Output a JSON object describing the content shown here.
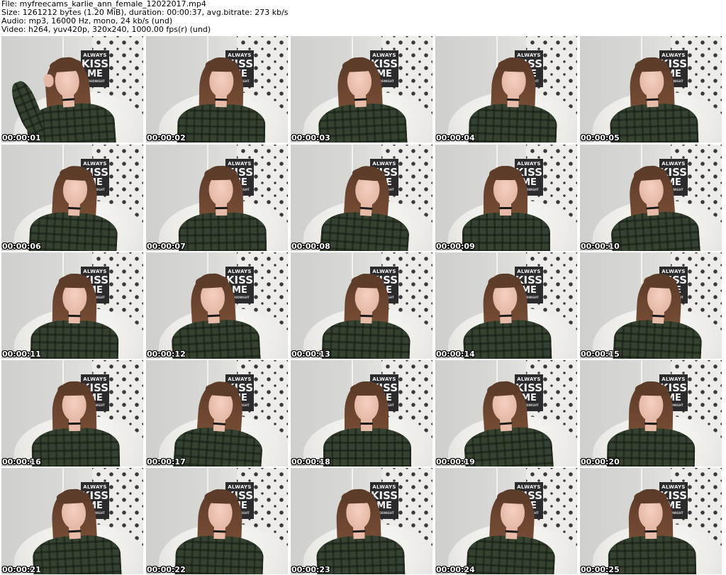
{
  "header": {
    "line1": "File: myfreecams_karlie_ann_female_12022017.mp4",
    "line2": "Size: 1261212 bytes (1.20 MiB), duration: 00:00:37, avg.bitrate: 273 kb/s",
    "line3": "Audio: mp3, 16000 Hz, mono, 24 kb/s (und)",
    "line4": "Video: h264, yuv420p, 320x240, 1000.00 fps(r) (und)"
  },
  "poster": {
    "line1": "ALWAYS",
    "line2": "KISS",
    "line3": "ME",
    "line4": "GOODNIGHT"
  },
  "thumbnails": [
    {
      "timestamp": "00:00:01"
    },
    {
      "timestamp": "00:00:02"
    },
    {
      "timestamp": "00:00:03"
    },
    {
      "timestamp": "00:00:04"
    },
    {
      "timestamp": "00:00:05"
    },
    {
      "timestamp": "00:00:06"
    },
    {
      "timestamp": "00:00:07"
    },
    {
      "timestamp": "00:00:08"
    },
    {
      "timestamp": "00:00:09"
    },
    {
      "timestamp": "00:00:10"
    },
    {
      "timestamp": "00:00:11"
    },
    {
      "timestamp": "00:00:12"
    },
    {
      "timestamp": "00:00:13"
    },
    {
      "timestamp": "00:00:14"
    },
    {
      "timestamp": "00:00:15"
    },
    {
      "timestamp": "00:00:16"
    },
    {
      "timestamp": "00:00:17"
    },
    {
      "timestamp": "00:00:18"
    },
    {
      "timestamp": "00:00:19"
    },
    {
      "timestamp": "00:00:20"
    },
    {
      "timestamp": "00:00:21"
    },
    {
      "timestamp": "00:00:22"
    },
    {
      "timestamp": "00:00:23"
    },
    {
      "timestamp": "00:00:24"
    },
    {
      "timestamp": "00:00:25"
    }
  ]
}
